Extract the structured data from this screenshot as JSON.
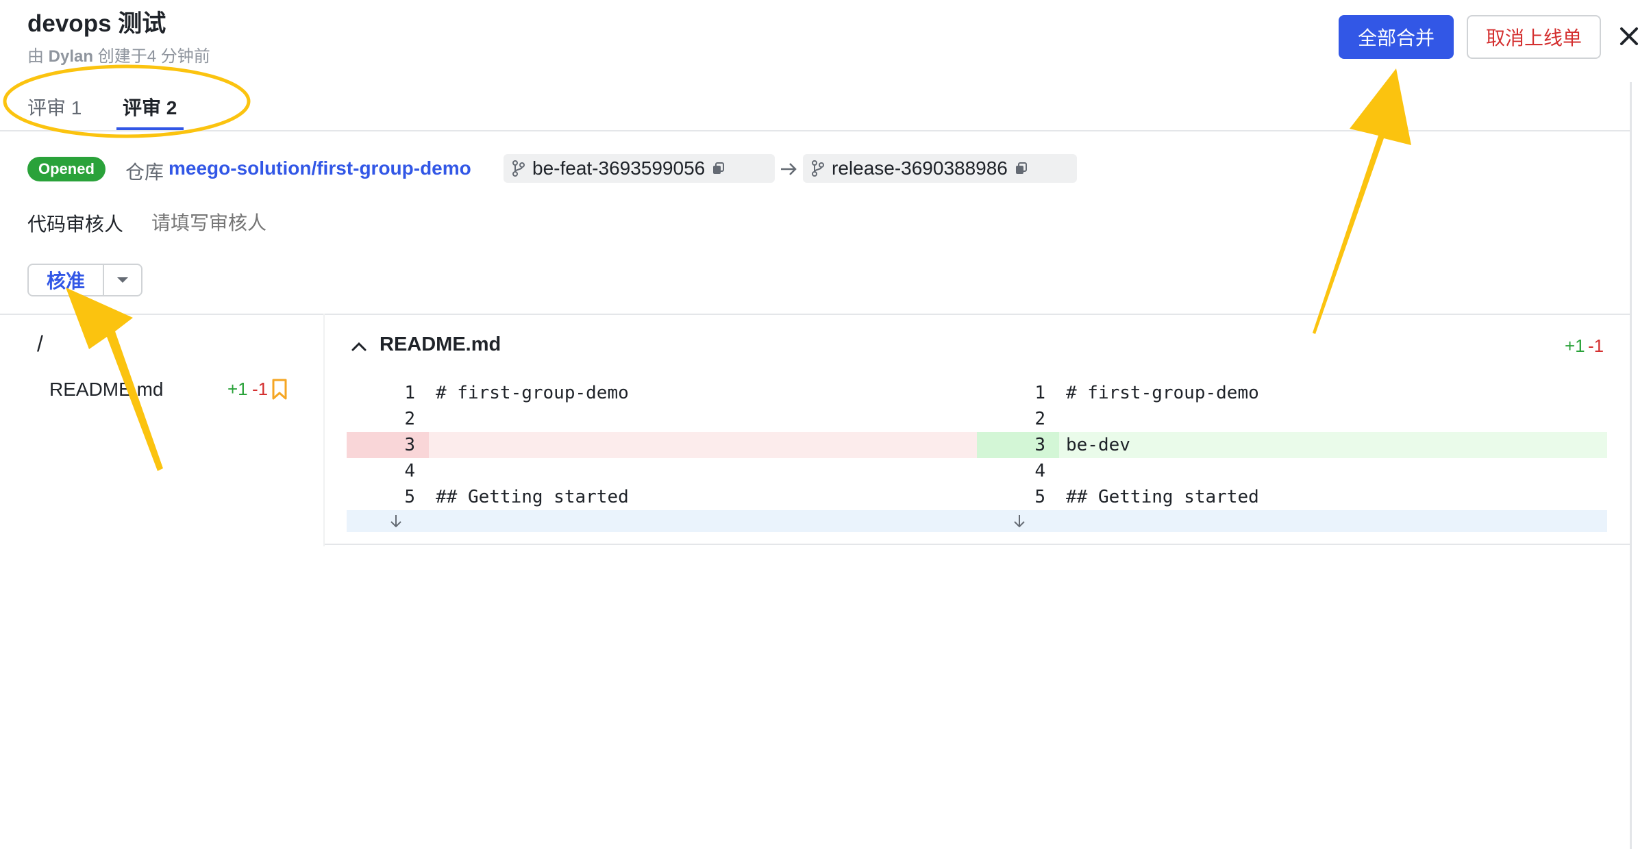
{
  "header": {
    "title": "devops 测试",
    "created_prefix": "由 ",
    "author": "Dylan",
    "created_suffix": " 创建于4 分钟前",
    "merge_all_label": "全部合并",
    "cancel_release_label": "取消上线单"
  },
  "tabs": [
    {
      "label": "评审 1",
      "active": false
    },
    {
      "label": "评审 2",
      "active": true
    }
  ],
  "merge_request": {
    "status": "Opened",
    "repo_label": "仓库",
    "repo_name": "meego-solution/first-group-demo",
    "source_branch": "be-feat-3693599056",
    "target_branch": "release-3690388986"
  },
  "reviewers": {
    "label": "代码审核人",
    "placeholder": "请填写审核人"
  },
  "approve": {
    "label": "核准"
  },
  "file_tree": {
    "root": "/",
    "files": [
      {
        "name": "README.md",
        "additions": "+1",
        "deletions": "-1"
      }
    ]
  },
  "diff": {
    "file_name": "README.md",
    "additions": "+1",
    "deletions": "-1",
    "rows": [
      {
        "left_ln": "1",
        "left_code": "# first-group-demo",
        "right_ln": "1",
        "right_code": "# first-group-demo",
        "type": "context"
      },
      {
        "left_ln": "2",
        "left_code": "",
        "right_ln": "2",
        "right_code": "",
        "type": "context"
      },
      {
        "left_ln": "3",
        "left_code": "",
        "right_ln": "3",
        "right_code": "be-dev",
        "type": "change"
      },
      {
        "left_ln": "4",
        "left_code": "",
        "right_ln": "4",
        "right_code": "",
        "type": "context"
      },
      {
        "left_ln": "5",
        "left_code": "## Getting started",
        "right_ln": "5",
        "right_code": "## Getting started",
        "type": "context"
      }
    ]
  },
  "colors": {
    "primary": "#3257e6",
    "danger": "#d43030",
    "success": "#2aa23a",
    "annotation": "#fbc30f"
  }
}
